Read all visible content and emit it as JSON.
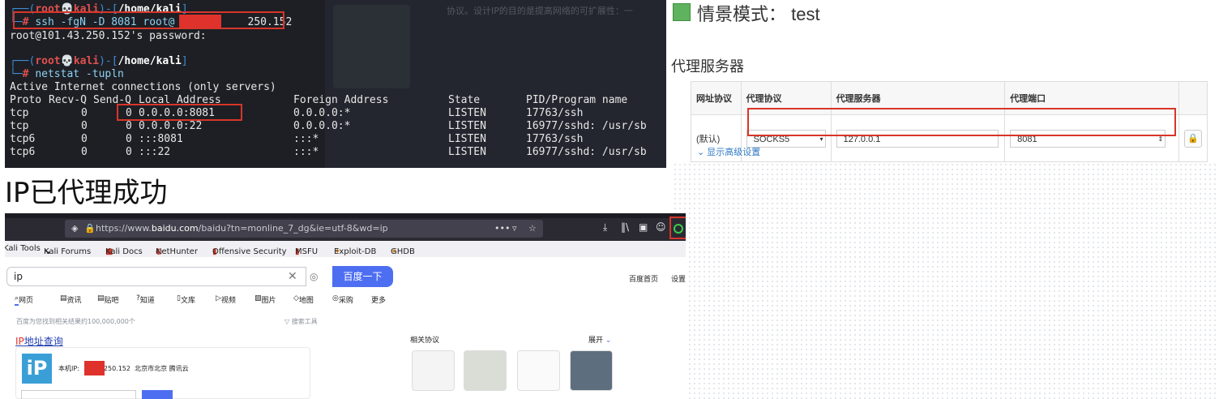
{
  "terminal": {
    "ghost_text": "协议。设计IP的目的是提高网络的可扩展性：一",
    "user": "root",
    "host": "kali",
    "dir": "/home/kali",
    "cmd1_before": "ssh -fgN -D 8081 root@",
    "cmd1_after": "250.152",
    "password_prompt": "root@101.43.250.152's password:",
    "cmd2": "netstat -tupln",
    "netstat_title": "Active Internet connections (only servers)",
    "header": {
      "proto": "Proto",
      "recvq": "Recv-Q",
      "sendq": "Send-Q",
      "local": "Local Address",
      "foreign": "Foreign Address",
      "state": "State",
      "pid": "PID/Program name"
    },
    "rows": [
      {
        "proto": "tcp",
        "recvq": "0",
        "sendq": "0",
        "local": "0.0.0.0:8081",
        "foreign": "0.0.0.0:*",
        "state": "LISTEN",
        "pid": "17763/ssh"
      },
      {
        "proto": "tcp",
        "recvq": "0",
        "sendq": "0",
        "local": "0.0.0.0:22",
        "foreign": "0.0.0.0:*",
        "state": "LISTEN",
        "pid": "16977/sshd: /usr/sb"
      },
      {
        "proto": "tcp6",
        "recvq": "0",
        "sendq": "0",
        "local": ":::8081",
        "foreign": ":::*",
        "state": "LISTEN",
        "pid": "17763/ssh"
      },
      {
        "proto": "tcp6",
        "recvq": "0",
        "sendq": "0",
        "local": ":::22",
        "foreign": ":::*",
        "state": "LISTEN",
        "pid": "16977/sshd: /usr/sb"
      }
    ]
  },
  "scene": {
    "label": "情景模式：",
    "name": "test",
    "swatch_color": "#5fb35f"
  },
  "proxy": {
    "heading": "代理服务器",
    "columns": [
      "网址协议",
      "代理协议",
      "代理服务器",
      "代理端口"
    ],
    "row_label": "(默认)",
    "protocol": "SOCKS5",
    "server": "127.0.0.1",
    "port": "8081",
    "advanced": "显示高级设置"
  },
  "caption": "IP已代理成功",
  "browser": {
    "url_prefix": "https://www.",
    "url_domain": "baidu.com",
    "url_rest": "/baidu?tn=monline_7_dg&ie=utf-8&wd=ip",
    "bookmarks": [
      "Kali Tools",
      "Kali Forums",
      "Kali Docs",
      "NetHunter",
      "Offensive Security",
      "MSFU",
      "Exploit-DB",
      "GHDB"
    ],
    "search_value": "ip",
    "search_button": "百度一下",
    "top_links": [
      "百度首页",
      "设置"
    ],
    "tabs": [
      "网页",
      "资讯",
      "贴吧",
      "知道",
      "文库",
      "视频",
      "图片",
      "地图",
      "采购",
      "更多"
    ],
    "result_count": "百度为您找到相关结果约100,000,000个",
    "search_tools": "搜索工具",
    "ip_title_accent": "IP",
    "ip_title_rest": "地址查询",
    "ip_label": "本机IP:",
    "ip_value": "250.152",
    "ip_location": "北京市北京 腾讯云",
    "related_title": "相关协议",
    "expand": "展开",
    "accent_color": "#4e6ef2"
  }
}
